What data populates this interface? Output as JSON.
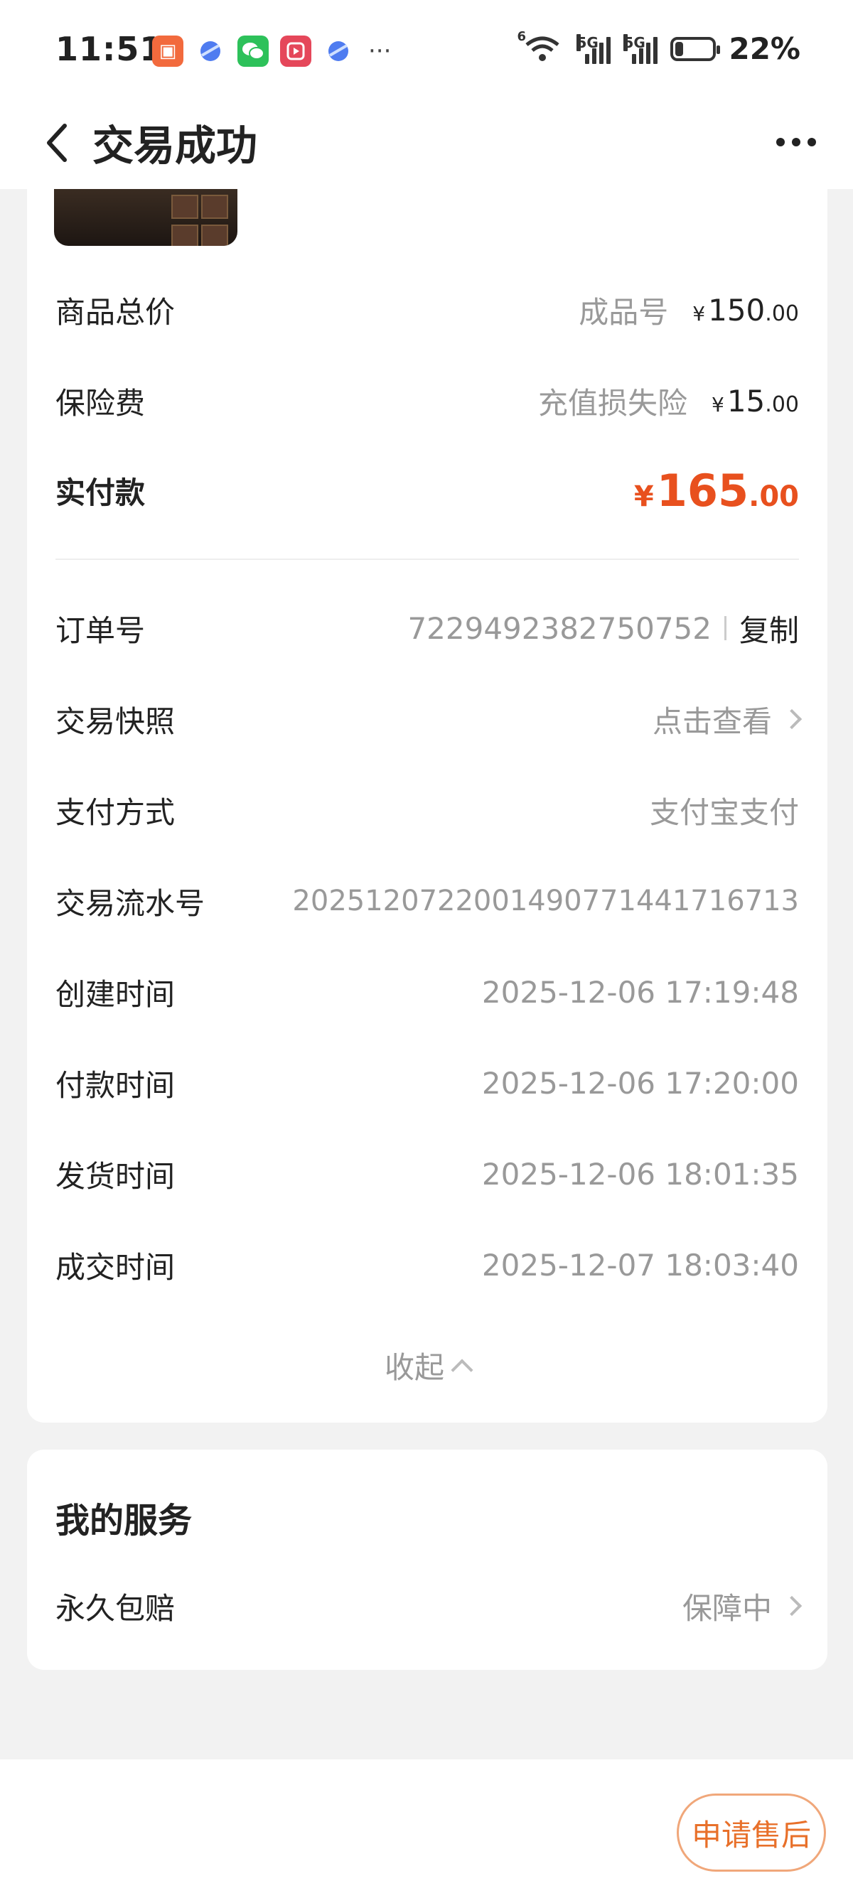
{
  "status_bar": {
    "time": "11:51",
    "battery_percent": "22%",
    "network": "5G",
    "wifi": "6",
    "battery_level": 0.22
  },
  "header": {
    "title": "交易成功"
  },
  "prices": {
    "goods_total_label": "商品总价",
    "goods_type": "成品号",
    "goods_total_currency": "¥",
    "goods_total_int": "150",
    "goods_total_dec": ".00",
    "insurance_label": "保险费",
    "insurance_type": "充值损失险",
    "insurance_currency": "¥",
    "insurance_int": "15",
    "insurance_dec": ".00",
    "paid_label": "实付款",
    "paid_currency": "¥",
    "paid_int": "165",
    "paid_dec": ".00"
  },
  "order": {
    "order_no_label": "订单号",
    "order_no": "7229492382750752",
    "copy_label": "复制",
    "snapshot_label": "交易快照",
    "snapshot_action": "点击查看",
    "pay_method_label": "支付方式",
    "pay_method": "支付宝支付",
    "serial_label": "交易流水号",
    "serial": "2025120722001490771441716713",
    "created_label": "创建时间",
    "created": "2025-12-06 17:19:48",
    "paid_time_label": "付款时间",
    "paid_time": "2025-12-06 17:20:00",
    "shipped_label": "发货时间",
    "shipped": "2025-12-06 18:01:35",
    "done_label": "成交时间",
    "done": "2025-12-07 18:03:40",
    "collapse_label": "收起"
  },
  "services": {
    "title": "我的服务",
    "item_label": "永久包赔",
    "item_status": "保障中"
  },
  "footer": {
    "after_sale_label": "申请售后"
  },
  "colors": {
    "accent": "#e8501e",
    "button_text": "#e8702a",
    "button_border": "#f0a77a"
  }
}
